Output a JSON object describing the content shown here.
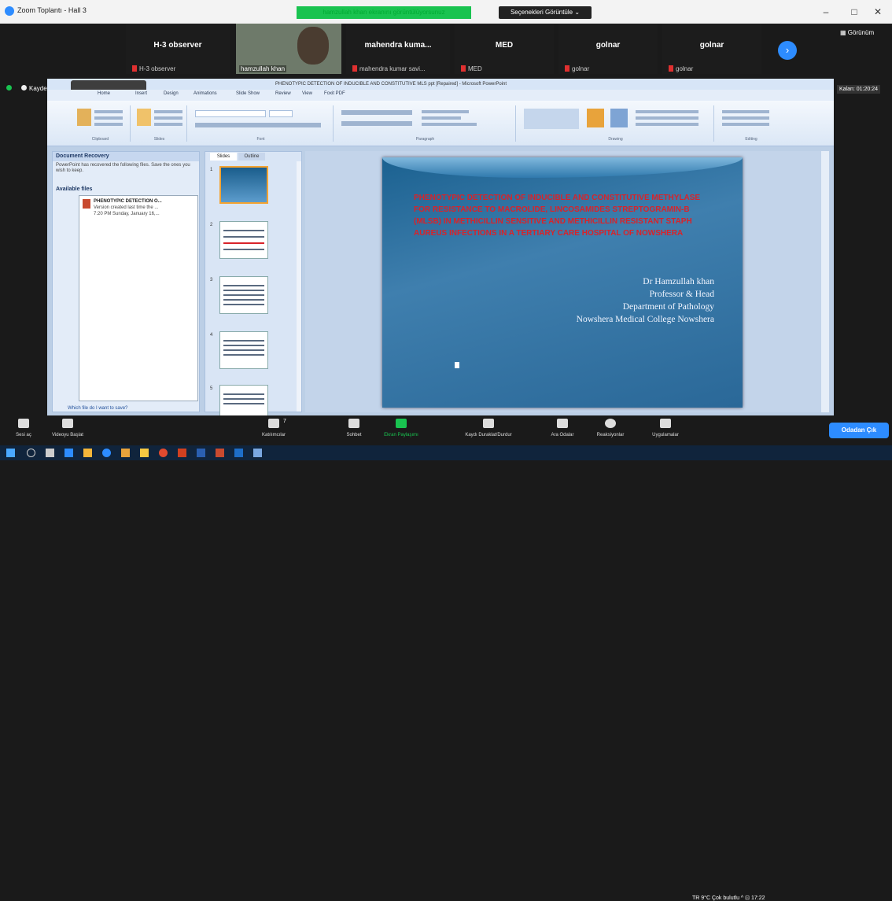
{
  "window": {
    "title": "Zoom Toplantı - Hall 3",
    "minimize": "–",
    "maximize": "□",
    "close": "✕"
  },
  "share_banner": "hamzullah khan ekranını görüntülüyorsunuz",
  "view_options": "Seçenekleri Görüntüle ⌄",
  "gallery_view": "▦ Görünüm",
  "participants": [
    {
      "name": "H-3 observer",
      "sub": "H-3 observer"
    },
    {
      "name": "",
      "sub": "hamzullah khan"
    },
    {
      "name": "mahendra kuma...",
      "sub": "mahendra kumar savi..."
    },
    {
      "name": "MED",
      "sub": "MED"
    },
    {
      "name": "golnar",
      "sub": "golnar"
    },
    {
      "name": "golnar",
      "sub": "golnar"
    }
  ],
  "next_page": "›",
  "status_left": "Kaydediliyor...",
  "timer": "Kalan: 01:20:24",
  "powerpoint": {
    "title": "PHENOTYPIC DETECTION OF INDUCIBLE AND CONSTITUTIVE MLS ppt [Repaired] - Microsoft PowerPoint",
    "tabs": [
      "Home",
      "Insert",
      "Design",
      "Animations",
      "Slide Show",
      "Review",
      "View",
      "Foxit PDF"
    ],
    "groups": [
      "Clipboard",
      "Slides",
      "Font",
      "Paragraph",
      "Drawing",
      "Editing"
    ],
    "recovery": {
      "header": "Document Recovery",
      "text": "PowerPoint has recovered the following files. Save the ones you wish to keep.",
      "available": "Available files",
      "file_name": "PHENOTYPIC DETECTION O...",
      "file_sub1": "Version created last time the ...",
      "file_sub2": "7:20 PM Sunday, January 16,...",
      "link": "Which file do I want to save?"
    },
    "thumb_tabs": [
      "Slides",
      "Outline"
    ],
    "thumb_numbers": [
      "1",
      "2",
      "3",
      "4",
      "5"
    ],
    "slide": {
      "title": "PHENOTYPIC DETECTION OF INDUCIBLE AND CONSTITUTIVE METHYLASE FOR RESISTANCE TO MACROLIDE, LINCOSAMIDES STREPTOGRAMIN-B (MLSB) IN METHICILLIN SENSITIVE AND METHICILLIN RESISTANT STAPH AUREUS INFECTIONS IN A TERTIARY CARE HOSPITAL OF NOWSHERA",
      "author": [
        "Dr Hamzullah khan",
        "Professor & Head",
        "Department of Pathology",
        "Nowshera Medical College Nowshera"
      ]
    }
  },
  "toolbar": [
    {
      "label": "Sesi aç"
    },
    {
      "label": "Videoyu Başlat"
    },
    {
      "label": "Katılımcılar"
    },
    {
      "label": "Sohbet"
    },
    {
      "label": "Ekran Paylaşımı"
    },
    {
      "label": "Kaydı Duraklat/Durdur"
    },
    {
      "label": "Ara Odalar"
    },
    {
      "label": "Reaksiyonlar"
    },
    {
      "label": "Uygulamalar"
    }
  ],
  "participant_count": "7",
  "leave": "Odadan Çık",
  "taskbar": {
    "tray": "TR   9°C Çok bulutlu  ^  ⊡  17:22"
  }
}
